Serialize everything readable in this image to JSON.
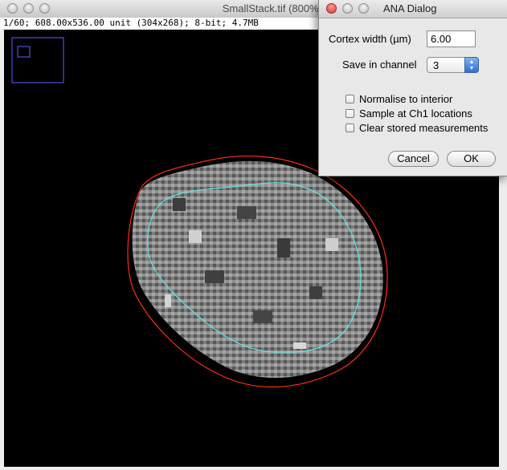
{
  "image_window": {
    "title": "SmallStack.tif (800%)",
    "info_line": "1/60; 608.00x536.00 unit (304x268); 8-bit; 4.7MB"
  },
  "dialog": {
    "title": "ANA Dialog",
    "cortex_width_label": "Cortex width (µm)",
    "cortex_width_value": "6.00",
    "save_channel_label": "Save in channel",
    "save_channel_value": "3",
    "checkboxes": [
      {
        "label": "Normalise to interior",
        "checked": false
      },
      {
        "label": "Sample at Ch1 locations",
        "checked": false
      },
      {
        "label": "Clear stored measurements",
        "checked": false
      }
    ],
    "cancel_label": "Cancel",
    "ok_label": "OK"
  },
  "colors": {
    "outer_roi": "#ff2a1a",
    "inner_roi": "#5fe6e6",
    "navigator": "#6060ff"
  }
}
